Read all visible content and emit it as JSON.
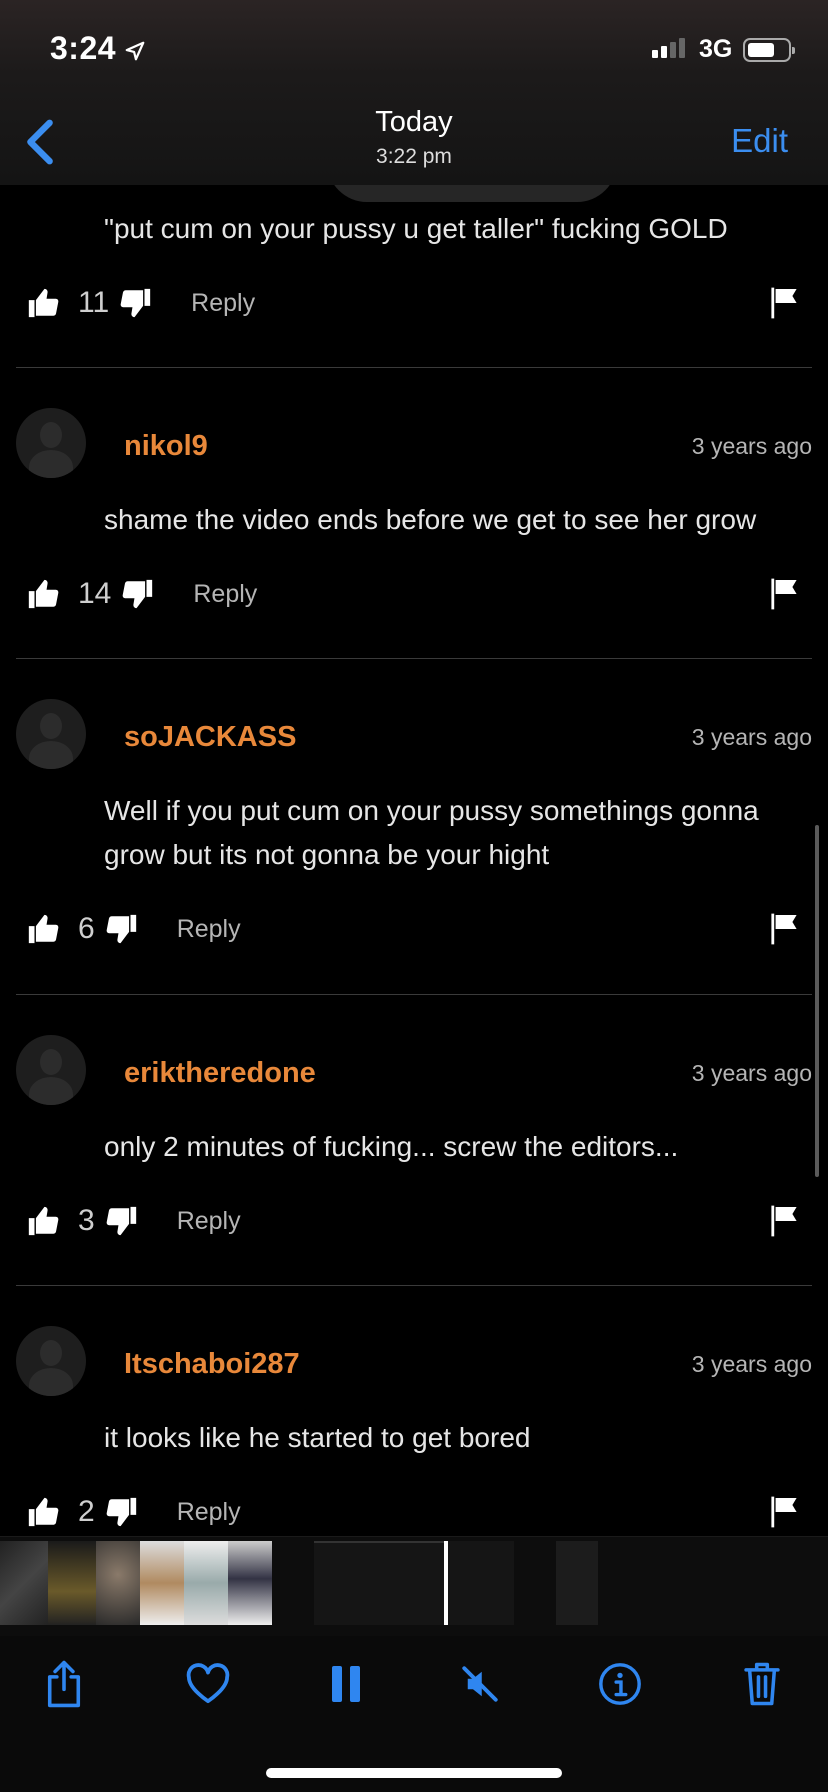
{
  "status_bar": {
    "time": "3:24",
    "network": "3G"
  },
  "nav": {
    "title": "Today",
    "subtitle": "3:22 pm",
    "edit_label": "Edit"
  },
  "first_comment": {
    "text": "\"put cum on your pussy u get taller\" fucking GOLD",
    "likes": "11",
    "reply_label": "Reply"
  },
  "comments": [
    {
      "username": "nikol9",
      "time": "3 years ago",
      "text": "shame the video ends before we get to see her grow",
      "likes": "14",
      "reply_label": "Reply"
    },
    {
      "username": "soJACKASS",
      "time": "3 years ago",
      "text": "Well if you put cum on your pussy somethings gonna grow but its not gonna be your hight",
      "likes": "6",
      "reply_label": "Reply"
    },
    {
      "username": "eriktheredone",
      "time": "3 years ago",
      "text": "only 2 minutes of fucking... screw the editors...",
      "likes": "3",
      "reply_label": "Reply"
    },
    {
      "username": "Itschaboi287",
      "time": "3 years ago",
      "text": "it looks like he started to get bored",
      "likes": "2",
      "reply_label": "Reply"
    }
  ],
  "toolbar": {
    "buttons": [
      "share-icon",
      "heart-icon",
      "pause-icon",
      "mute-icon",
      "info-icon",
      "trash-icon"
    ],
    "accent_color": "#2f86f0"
  },
  "colors": {
    "username": "#e8883a",
    "link": "#3b8ef0",
    "background": "#000000"
  }
}
